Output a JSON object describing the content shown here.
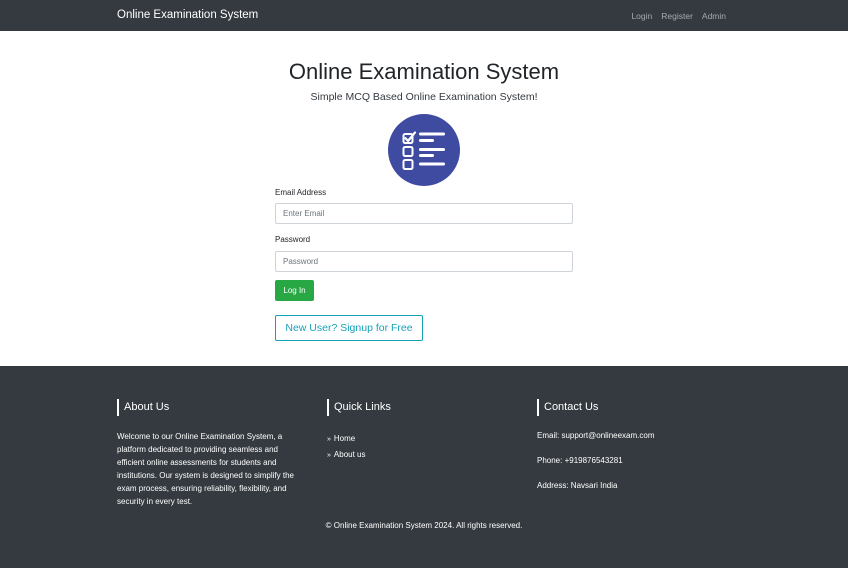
{
  "navbar": {
    "brand": "Online Examination System",
    "links": [
      "Login",
      "Register",
      "Admin"
    ]
  },
  "hero": {
    "title": "Online Examination System",
    "subtitle": "Simple MCQ Based Online Examination System!",
    "logo_icon": "checklist-icon",
    "logo_color": "#3e4ba0"
  },
  "login_form": {
    "email_label": "Email Address",
    "email_placeholder": "Enter Email",
    "email_value": "",
    "password_label": "Password",
    "password_placeholder": "Password",
    "password_value": "",
    "login_button": "Log In",
    "signup_button": "New User? Signup for Free"
  },
  "footer": {
    "about": {
      "heading": "About Us",
      "text": "Welcome to our Online Examination System, a platform dedicated to providing seamless and efficient online assessments for students and institutions. Our system is designed to simplify the exam process, ensuring reliability, flexibility, and security in every test."
    },
    "quick_links": {
      "heading": "Quick Links",
      "items": [
        "Home",
        "About us"
      ]
    },
    "contact": {
      "heading": "Contact Us",
      "email": "Email: support@onlineexam.com",
      "phone": "Phone: +919876543281",
      "address": "Address: Navsari India"
    },
    "copyright": "© Online Examination System 2024. All rights reserved."
  },
  "colors": {
    "navbar_bg": "#343a40",
    "success": "#28a745",
    "info": "#17a2b8"
  }
}
